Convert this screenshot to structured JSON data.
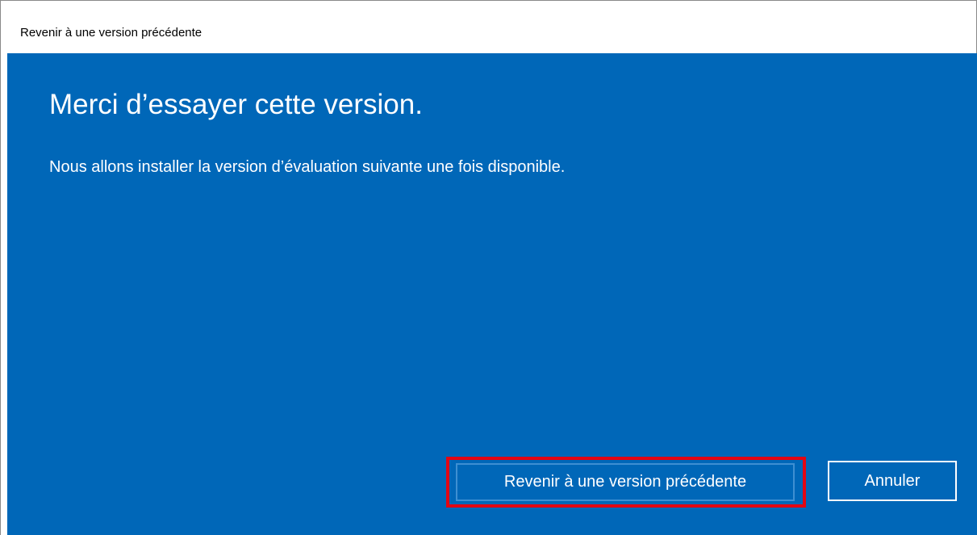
{
  "window": {
    "title": "Revenir à une version précédente"
  },
  "main": {
    "heading": "Merci d’essayer cette version.",
    "message": "Nous allons installer la version d’évaluation suivante une fois disponible."
  },
  "buttons": {
    "rollback_label": "Revenir à une version précédente",
    "cancel_label": "Annuler"
  },
  "colors": {
    "background_blue": "#0067b8",
    "highlight_red": "#e30613",
    "text_white": "#ffffff"
  }
}
